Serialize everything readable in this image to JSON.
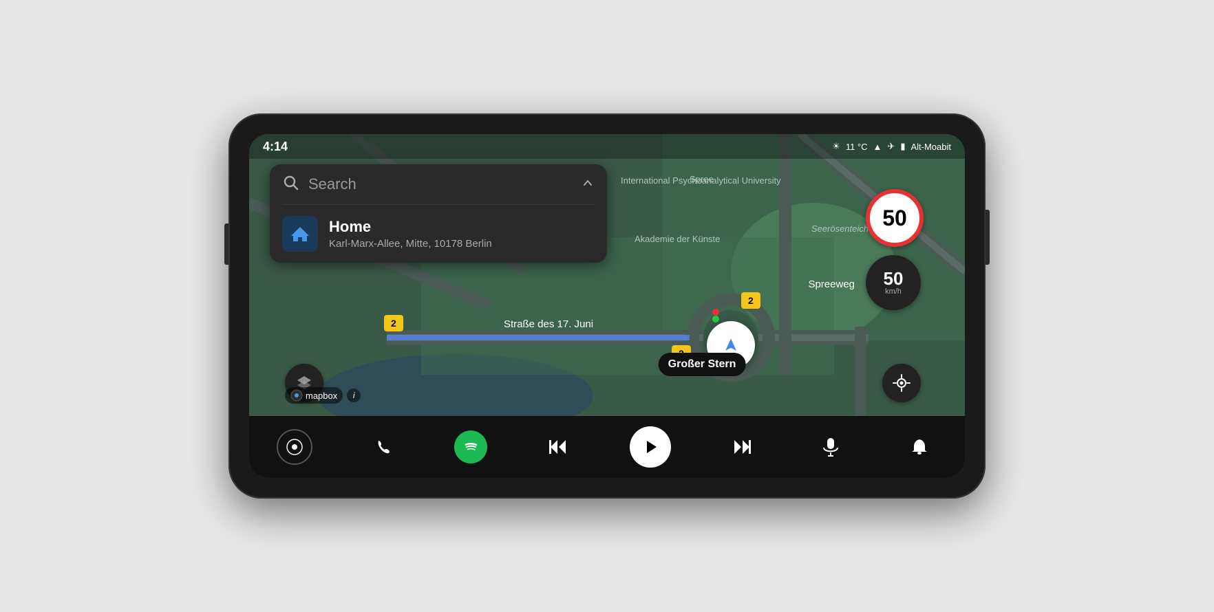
{
  "device": {
    "time": "4:14"
  },
  "status_bar": {
    "time": "4:14",
    "temperature": "11 °C",
    "location": "Alt-Moabit"
  },
  "search": {
    "placeholder": "Search",
    "chevron": "⌃"
  },
  "search_result": {
    "title": "Home",
    "subtitle": "Karl-Marx-Allee, Mitte, 10178 Berlin"
  },
  "speed_limit": {
    "value": "50"
  },
  "current_speed": {
    "value": "50",
    "unit": "km/h"
  },
  "map_labels": {
    "road1": "Straße des 17. Juni",
    "road2": "Spreeweg",
    "place1": "Akademie der Künste",
    "place2": "International Psychoanalytical University",
    "place3": "Spree",
    "poi": "Großer Stern",
    "waterway": "Seerösenteich"
  },
  "mapbox": {
    "logo": "mapbox",
    "info": "i"
  },
  "bottom_nav": {
    "home_label": "Home",
    "phone_label": "Phone",
    "spotify_label": "Spotify",
    "prev_label": "Previous",
    "play_label": "Play",
    "next_label": "Next",
    "mic_label": "Microphone",
    "bell_label": "Notifications"
  }
}
